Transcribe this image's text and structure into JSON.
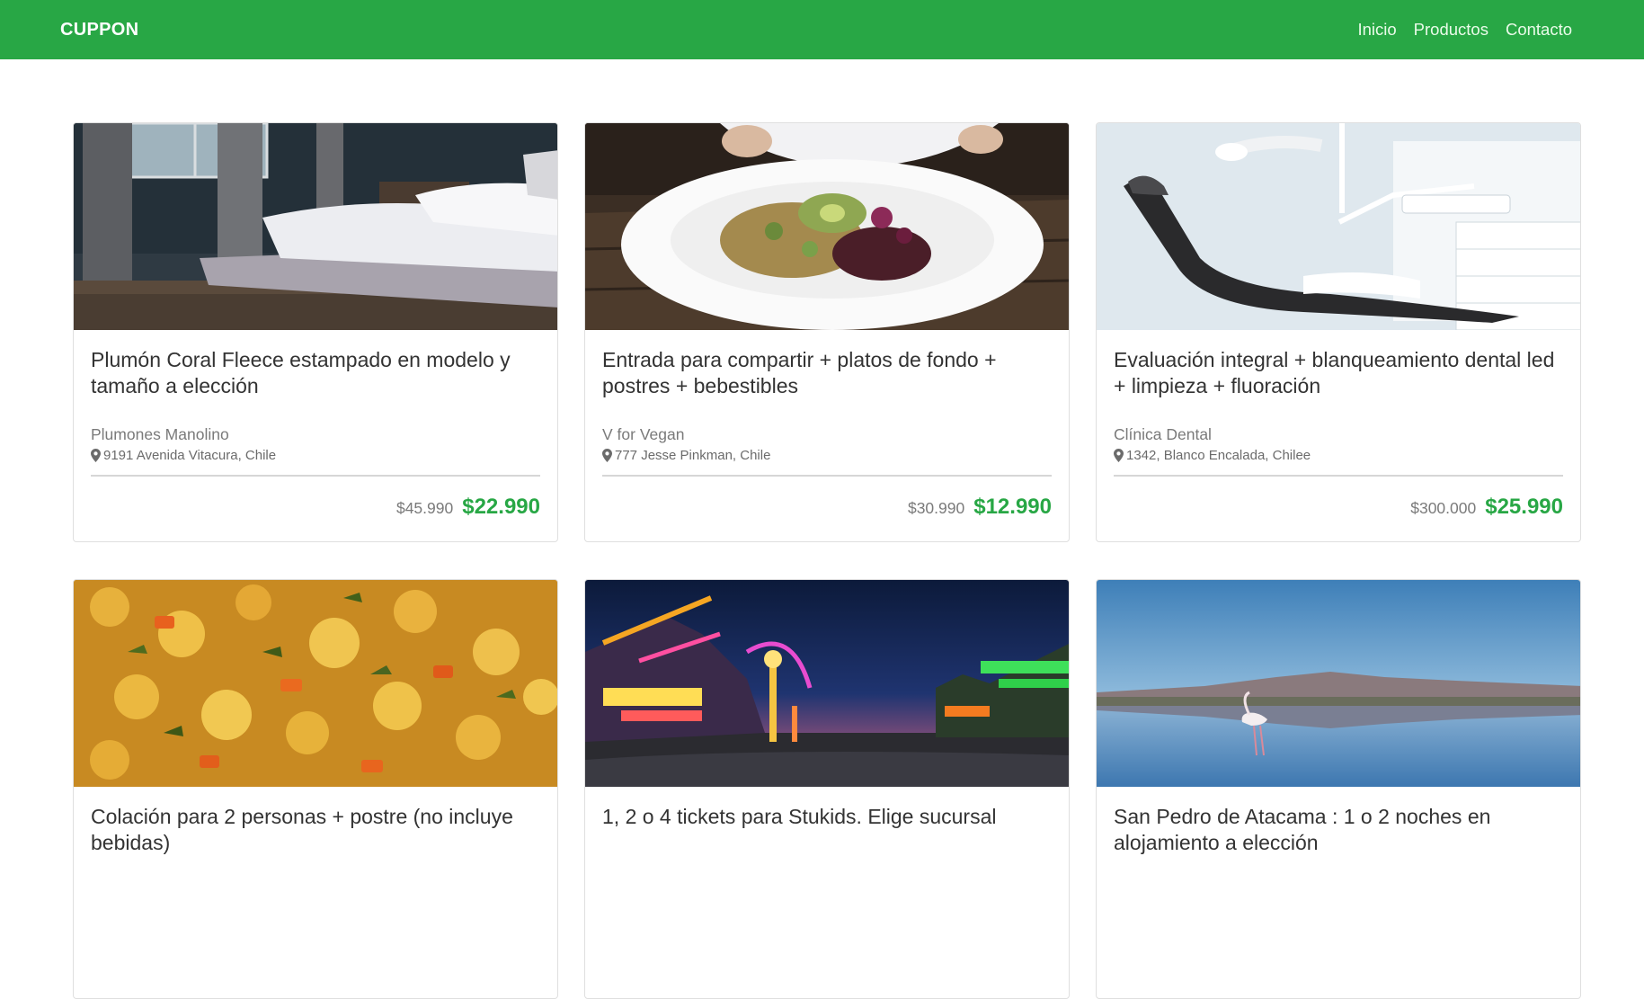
{
  "nav": {
    "brand": "CUPPON",
    "links": [
      "Inicio",
      "Productos",
      "Contacto"
    ]
  },
  "colors": {
    "accent": "#28a745"
  },
  "cards": [
    {
      "title": "Plumón Coral Fleece estampado en modelo y tamaño a elección",
      "merchant": "Plumones Manolino",
      "address": "9191 Avenida Vitacura, Chile",
      "old_price": "$45.990",
      "new_price": "$22.990",
      "image": "bedroom"
    },
    {
      "title": "Entrada para compartir + platos de fondo + postres + bebestibles",
      "merchant": "V for Vegan",
      "address": "777 Jesse Pinkman, Chile",
      "old_price": "$30.990",
      "new_price": "$12.990",
      "image": "salad-plate"
    },
    {
      "title": "Evaluación integral + blanqueamiento dental led + limpieza + fluoración",
      "merchant": "Clínica Dental",
      "address": "1342, Blanco Encalada, Chilee",
      "old_price": "$300.000",
      "new_price": "$25.990",
      "image": "dental-chair"
    },
    {
      "title": "Colación para 2 personas + postre (no incluye bebidas)",
      "merchant": "",
      "address": "",
      "old_price": "",
      "new_price": "",
      "image": "lentil-stew"
    },
    {
      "title": "1, 2 o 4 tickets para Stukids. Elige sucursal",
      "merchant": "",
      "address": "",
      "old_price": "",
      "new_price": "",
      "image": "amusement-park"
    },
    {
      "title": "San Pedro de Atacama : 1 o 2 noches en alojamiento a elección",
      "merchant": "",
      "address": "",
      "old_price": "",
      "new_price": "",
      "image": "flamingo-lake"
    }
  ]
}
